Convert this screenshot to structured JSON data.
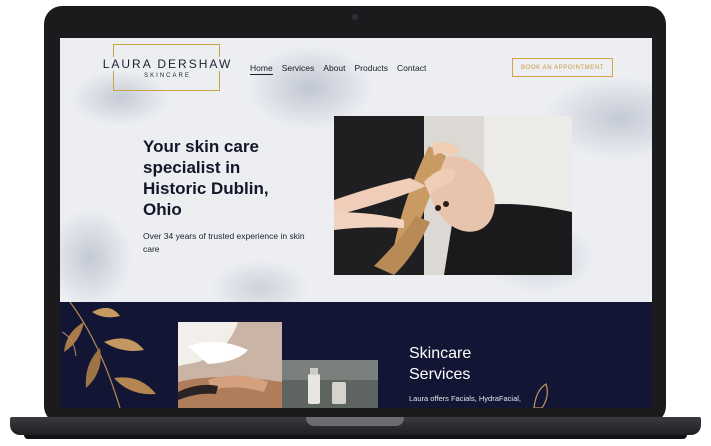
{
  "brand": {
    "name": "LAURA DERSHAW",
    "tagline": "SKINCARE",
    "accent_color": "#c9a24a",
    "navy_color": "#121533"
  },
  "nav": {
    "items": [
      {
        "label": "Home",
        "active": true
      },
      {
        "label": "Services",
        "active": false
      },
      {
        "label": "About",
        "active": false
      },
      {
        "label": "Products",
        "active": false
      },
      {
        "label": "Contact",
        "active": false
      }
    ],
    "cta_label": "BOOK AN APPOINTMENT"
  },
  "hero": {
    "headline": "Your skin care specialist in Historic Dublin, Ohio",
    "subline": "Over 34 years of trusted experience in skin care"
  },
  "services": {
    "title_line1": "Skincare",
    "title_line2": "Services",
    "text": "Laura offers Facials, HydraFacial,"
  },
  "icons": [
    "leaf-decoration-icon"
  ]
}
